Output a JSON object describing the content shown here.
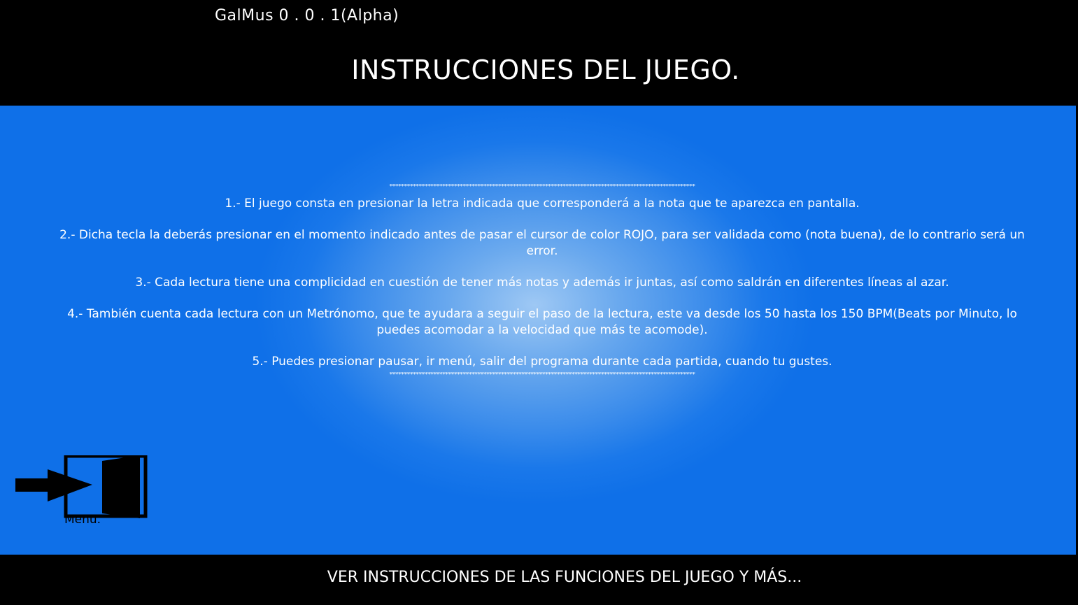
{
  "app": {
    "title": "GalMus 0 . 0 . 1(Alpha)"
  },
  "header": {
    "page_title": "INSTRUCCIONES DEL JUEGO."
  },
  "instructions": {
    "separator": "********************************************************************************************************",
    "items": [
      "1.- El juego consta en presionar la letra indicada que corresponderá a la nota que te aparezca en pantalla.",
      "2.- Dicha tecla la deberás presionar en el momento indicado antes de pasar el cursor de color ROJO, para ser validada como (nota buena), de lo contrario será un error.",
      "3.- Cada lectura tiene una complicidad en cuestión de tener más notas y además ir juntas, así como saldrán en diferentes líneas al azar.",
      "4.- También cuenta cada lectura con un Metrónomo, que te ayudara a seguir el paso de la lectura, este va desde los 50 hasta los 150 BPM(Beats por Minuto, lo puedes acomodar a la velocidad que más te acomode).",
      "5.- Puedes presionar pausar, ir menú, salir del programa durante cada partida, cuando tu gustes."
    ]
  },
  "menu_button": {
    "label": "Menu.",
    "icon": "exit-door-icon"
  },
  "footer": {
    "button_label": "VER INSTRUCCIONES DE LAS FUNCIONES DEL JUEGO Y MÁS..."
  },
  "colors": {
    "background": "#000000",
    "panel_blue": "#0f70e8",
    "panel_glow": "#9ec8f4",
    "text": "#ffffff"
  }
}
